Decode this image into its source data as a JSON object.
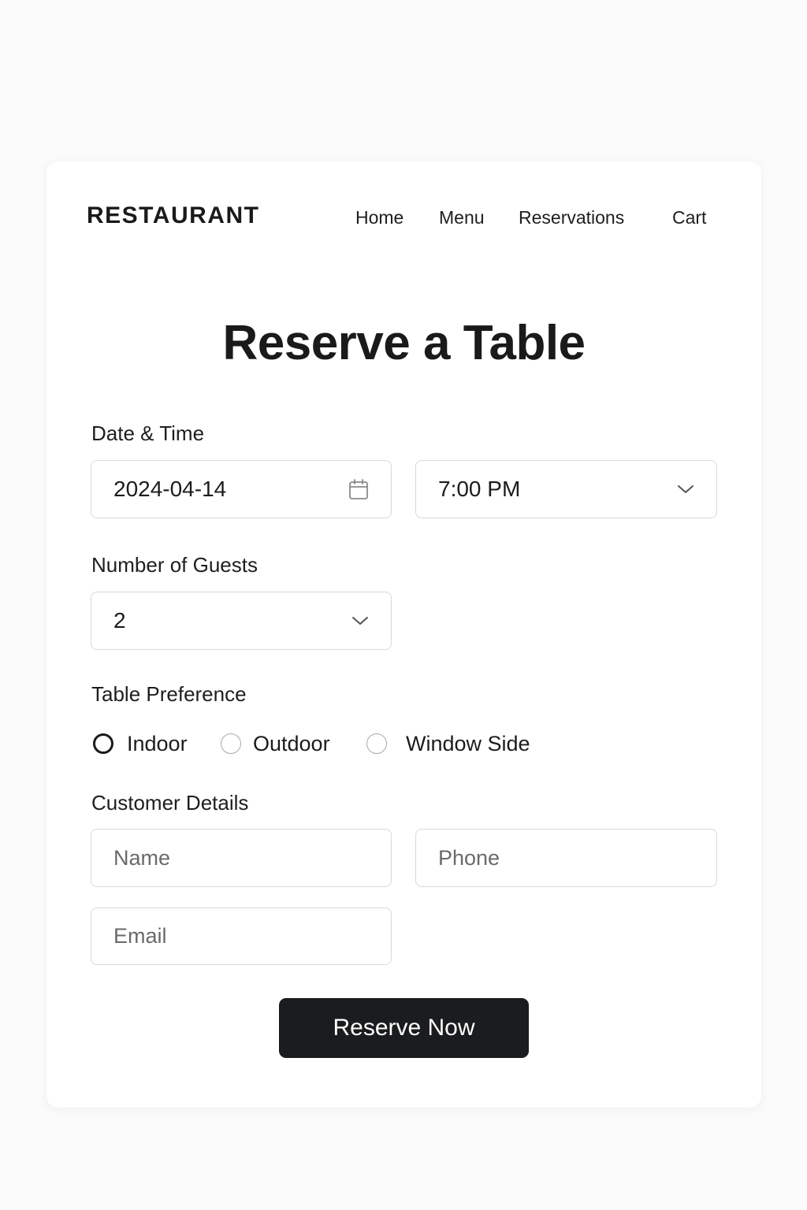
{
  "header": {
    "brand": "RESTAURANT",
    "nav": [
      "Home",
      "Menu",
      "Reservations",
      "Cart"
    ]
  },
  "page_title": "Reserve a Table",
  "date_time": {
    "label": "Date & Time",
    "date_value": "2024-04-14",
    "date_icon": "calendar-icon",
    "time_value": "7:00 PM",
    "time_icon": "chevron-down-icon"
  },
  "guests": {
    "label": "Number of Guests",
    "value": "2",
    "icon": "chevron-down-icon"
  },
  "table_preference": {
    "label": "Table Preference",
    "options": [
      {
        "label": "Indoor",
        "selected": true
      },
      {
        "label": "Outdoor",
        "selected": false
      },
      {
        "label": "Window Side",
        "selected": false
      }
    ]
  },
  "customer_details": {
    "label": "Customer Details",
    "name_placeholder": "Name",
    "phone_placeholder": "Phone",
    "email_placeholder": "Email"
  },
  "submit_label": "Reserve Now",
  "colors": {
    "button_background": "#1b1c1e",
    "button_text": "#ffffff",
    "text": "#1c1c1c",
    "field_border": "#d9d9d9"
  }
}
